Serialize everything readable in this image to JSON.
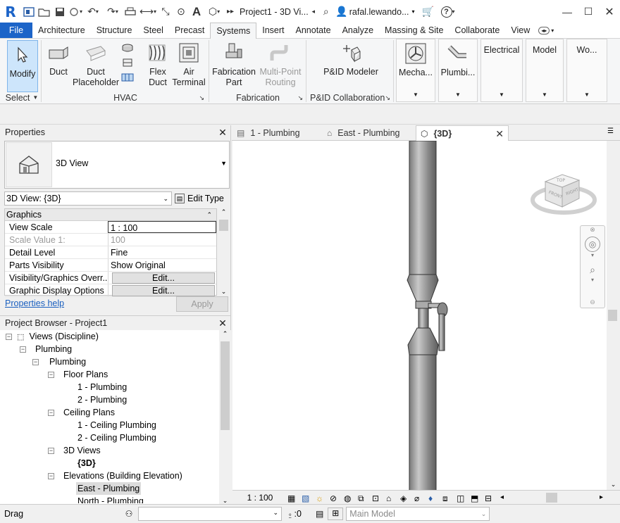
{
  "titlebar": {
    "doc_title": "Project1 - 3D Vi...",
    "user": "rafal.lewando...",
    "app_logo": "R"
  },
  "ribbon_tabs": [
    "File",
    "Architecture",
    "Structure",
    "Steel",
    "Precast",
    "Systems",
    "Insert",
    "Annotate",
    "Analyze",
    "Massing & Site",
    "Collaborate",
    "View"
  ],
  "ribbon_tabs_active": "Systems",
  "ribbon": {
    "modify": "Modify",
    "duct": "Duct",
    "duct_placeholder": "Duct\nPlaceholder",
    "flex_duct": "Flex\nDuct",
    "air_terminal": "Air\nTerminal",
    "fabrication_part": "Fabrication\nPart",
    "multipoint_routing": "Multi-Point\nRouting",
    "pid_modeler": "P&ID Modeler",
    "mecha": "Mecha...",
    "plumbi": "Plumbi...",
    "electrical": "Electrical",
    "model": "Model",
    "wo": "Wo...",
    "panel_select": "Select",
    "panel_hvac": "HVAC",
    "panel_fabrication": "Fabrication",
    "panel_pid": "P&ID Collaboration"
  },
  "properties": {
    "title": "Properties",
    "type_name": "3D View",
    "instance_selector": "3D View: {3D}",
    "edit_type": "Edit Type",
    "section": "Graphics",
    "rows": [
      {
        "k": "View Scale",
        "v": "1 : 100"
      },
      {
        "k": "Scale Value    1:",
        "v": "100"
      },
      {
        "k": "Detail Level",
        "v": "Fine"
      },
      {
        "k": "Parts Visibility",
        "v": "Show Original"
      },
      {
        "k": "Visibility/Graphics Overr...",
        "v": "Edit..."
      },
      {
        "k": "Graphic Display Options",
        "v": "Edit..."
      }
    ],
    "help": "Properties help",
    "apply": "Apply"
  },
  "browser": {
    "title": "Project Browser - Project1",
    "items": [
      "Views (Discipline)",
      "Plumbing",
      "Plumbing",
      "Floor Plans",
      "1 - Plumbing",
      "2 - Plumbing",
      "Ceiling Plans",
      "1 - Ceiling Plumbing",
      "2 - Ceiling Plumbing",
      "3D Views",
      "{3D}",
      "Elevations (Building Elevation)",
      "East - Plumbing",
      "North - Plumbing"
    ]
  },
  "view_tabs": [
    "1 - Plumbing",
    "East - Plumbing",
    "{3D}"
  ],
  "viewcube": {
    "top": "TOP",
    "front": "FRONT",
    "right": "RIGHT"
  },
  "viewbar": {
    "scale": "1 : 100"
  },
  "statusbar": {
    "mode": "Drag",
    "sel_count": ":0",
    "model": "Main Model"
  },
  "colors": {
    "accent": "#1c64c8",
    "file_tab": "#1c64c8",
    "selected_bg": "#cde5fb"
  }
}
